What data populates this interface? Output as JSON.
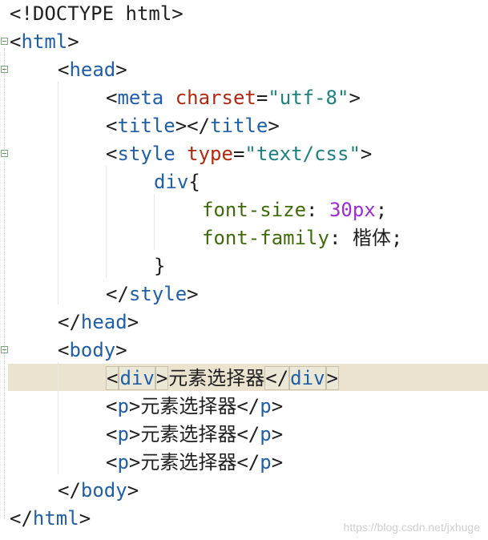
{
  "editor": {
    "lines": [
      {
        "indent": 0,
        "tokens": [
          {
            "t": "punc",
            "v": "<!DOCTYPE html>"
          }
        ]
      },
      {
        "indent": 0,
        "tokens": [
          {
            "t": "punc",
            "v": "<"
          },
          {
            "t": "tag",
            "v": "html"
          },
          {
            "t": "punc",
            "v": ">"
          }
        ]
      },
      {
        "indent": 1,
        "tokens": [
          {
            "t": "punc",
            "v": "<"
          },
          {
            "t": "tag",
            "v": "head"
          },
          {
            "t": "punc",
            "v": ">"
          }
        ]
      },
      {
        "indent": 2,
        "tokens": [
          {
            "t": "punc",
            "v": "<"
          },
          {
            "t": "tag",
            "v": "meta"
          },
          {
            "t": "text",
            "v": " "
          },
          {
            "t": "attr",
            "v": "charset"
          },
          {
            "t": "punc",
            "v": "="
          },
          {
            "t": "string",
            "v": "\"utf-8\""
          },
          {
            "t": "punc",
            "v": ">"
          }
        ]
      },
      {
        "indent": 2,
        "tokens": [
          {
            "t": "punc",
            "v": "<"
          },
          {
            "t": "tag",
            "v": "title"
          },
          {
            "t": "punc",
            "v": "></"
          },
          {
            "t": "tag",
            "v": "title"
          },
          {
            "t": "punc",
            "v": ">"
          }
        ]
      },
      {
        "indent": 2,
        "tokens": [
          {
            "t": "punc",
            "v": "<"
          },
          {
            "t": "tag",
            "v": "style"
          },
          {
            "t": "text",
            "v": " "
          },
          {
            "t": "attr",
            "v": "type"
          },
          {
            "t": "punc",
            "v": "="
          },
          {
            "t": "string",
            "v": "\"text/css\""
          },
          {
            "t": "punc",
            "v": ">"
          }
        ]
      },
      {
        "indent": 3,
        "tokens": [
          {
            "t": "selector",
            "v": "div"
          },
          {
            "t": "punc",
            "v": "{"
          }
        ]
      },
      {
        "indent": 4,
        "tokens": [
          {
            "t": "property",
            "v": "font-size"
          },
          {
            "t": "punc",
            "v": ": "
          },
          {
            "t": "number",
            "v": "30px"
          },
          {
            "t": "punc",
            "v": ";"
          }
        ]
      },
      {
        "indent": 4,
        "tokens": [
          {
            "t": "property",
            "v": "font-family"
          },
          {
            "t": "punc",
            "v": ": "
          },
          {
            "t": "text",
            "v": "楷体"
          },
          {
            "t": "punc",
            "v": ";"
          }
        ]
      },
      {
        "indent": 3,
        "tokens": [
          {
            "t": "punc",
            "v": "}"
          }
        ]
      },
      {
        "indent": 2,
        "tokens": [
          {
            "t": "punc",
            "v": "</"
          },
          {
            "t": "tag",
            "v": "style"
          },
          {
            "t": "punc",
            "v": ">"
          }
        ]
      },
      {
        "indent": 1,
        "tokens": [
          {
            "t": "punc",
            "v": "</"
          },
          {
            "t": "tag",
            "v": "head"
          },
          {
            "t": "punc",
            "v": ">"
          }
        ]
      },
      {
        "indent": 1,
        "tokens": [
          {
            "t": "punc",
            "v": "<"
          },
          {
            "t": "tag",
            "v": "body"
          },
          {
            "t": "punc",
            "v": ">"
          }
        ]
      },
      {
        "indent": 2,
        "tokens": [
          {
            "t": "punc",
            "v": "<"
          },
          {
            "t": "tag",
            "v": "div"
          },
          {
            "t": "punc",
            "v": ">"
          },
          {
            "t": "text",
            "v": "元素选择器"
          },
          {
            "t": "punc",
            "v": "</"
          },
          {
            "t": "tag",
            "v": "div"
          },
          {
            "t": "punc",
            "v": ">"
          }
        ]
      },
      {
        "indent": 2,
        "tokens": [
          {
            "t": "punc",
            "v": "<"
          },
          {
            "t": "tag",
            "v": "p"
          },
          {
            "t": "punc",
            "v": ">"
          },
          {
            "t": "text",
            "v": "元素选择器"
          },
          {
            "t": "punc",
            "v": "</"
          },
          {
            "t": "tag",
            "v": "p"
          },
          {
            "t": "punc",
            "v": ">"
          }
        ]
      },
      {
        "indent": 2,
        "tokens": [
          {
            "t": "punc",
            "v": "<"
          },
          {
            "t": "tag",
            "v": "p"
          },
          {
            "t": "punc",
            "v": ">"
          },
          {
            "t": "text",
            "v": "元素选择器"
          },
          {
            "t": "punc",
            "v": "</"
          },
          {
            "t": "tag",
            "v": "p"
          },
          {
            "t": "punc",
            "v": ">"
          }
        ]
      },
      {
        "indent": 2,
        "tokens": [
          {
            "t": "punc",
            "v": "<"
          },
          {
            "t": "tag",
            "v": "p"
          },
          {
            "t": "punc",
            "v": ">"
          },
          {
            "t": "text",
            "v": "元素选择器"
          },
          {
            "t": "punc",
            "v": "</"
          },
          {
            "t": "tag",
            "v": "p"
          },
          {
            "t": "punc",
            "v": ">"
          }
        ]
      },
      {
        "indent": 1,
        "tokens": [
          {
            "t": "punc",
            "v": "</"
          },
          {
            "t": "tag",
            "v": "body"
          },
          {
            "t": "punc",
            "v": ">"
          }
        ]
      },
      {
        "indent": 0,
        "tokens": [
          {
            "t": "punc",
            "v": "</"
          },
          {
            "t": "tag",
            "v": "html"
          },
          {
            "t": "punc",
            "v": ">"
          }
        ]
      }
    ],
    "fold_markers": [
      1,
      2,
      5,
      12
    ],
    "active_line": 13
  },
  "watermark": "https://blog.csdn.net/jxhuge"
}
